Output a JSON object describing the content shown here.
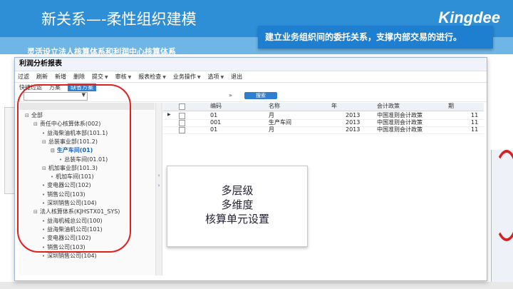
{
  "slide": {
    "title": "新关系—-柔性组织建模",
    "brand": "Kingdee",
    "subtitle": "灵活设立法人核算体系和利润中心核算体系",
    "callout": "建立业务组织间的委托关系，支撑内部交易的进行。"
  },
  "window": {
    "title": "利润分析报表",
    "toolbar": [
      "过滤",
      "刷新",
      "新增",
      "删除",
      "提交",
      "审核",
      "报表检查",
      "业务操作",
      "选项",
      "退出"
    ],
    "tabs": [
      "快捷过滤",
      "方案",
      "缺省方案"
    ],
    "search_label": "搜索",
    "collapse_icon": "double-chevron-down-icon"
  },
  "tree": [
    {
      "label": "全部",
      "level": 0,
      "toggle": "⊟"
    },
    {
      "label": "责任中心核算体系(002)",
      "level": 1,
      "toggle": "⊟"
    },
    {
      "label": "益海柴油机本部(101.1)",
      "level": 2,
      "toggle": "•"
    },
    {
      "label": "总装事业部(101.2)",
      "level": 2,
      "toggle": "⊟"
    },
    {
      "label": "生产车间(01)",
      "level": 3,
      "toggle": "⊟",
      "selected": true
    },
    {
      "label": "总装车间(01.01)",
      "level": 4,
      "toggle": "•"
    },
    {
      "label": "机加事业部(101.3)",
      "level": 2,
      "toggle": "⊟"
    },
    {
      "label": "机加车间(101)",
      "level": 3,
      "toggle": "•"
    },
    {
      "label": "变电器公司(102)",
      "level": 2,
      "toggle": "•"
    },
    {
      "label": "销售公司(103)",
      "level": 2,
      "toggle": "•"
    },
    {
      "label": "深圳销售公司(104)",
      "level": 2,
      "toggle": "•"
    },
    {
      "label": "法人核算体系(KJHSTX01_SYS)",
      "level": 1,
      "toggle": "⊟"
    },
    {
      "label": "益海机械总公司(100)",
      "level": 2,
      "toggle": "•"
    },
    {
      "label": "益海柴油机公司(101)",
      "level": 2,
      "toggle": "•"
    },
    {
      "label": "变电器公司(102)",
      "level": 2,
      "toggle": "•"
    },
    {
      "label": "销售公司(103)",
      "level": 2,
      "toggle": "•"
    },
    {
      "label": "深圳销售公司(104)",
      "level": 2,
      "toggle": "•"
    }
  ],
  "grid": {
    "headers": [
      "编码",
      "名称",
      "年",
      "会计政策",
      "期"
    ],
    "rows": [
      [
        "01",
        "月",
        "2013",
        "中国准则会计政策",
        "11"
      ],
      [
        "001",
        "生产车间",
        "2013",
        "中国准则会计政策",
        "11"
      ],
      [
        "01",
        "月",
        "2013",
        "中国准则会计政策",
        "11"
      ]
    ]
  },
  "textbox": [
    "多层级",
    "多维度",
    "核算单元设置"
  ],
  "colors": {
    "header": "#2e8fd6",
    "callout": "#1e7fd0",
    "highlight": "#e02020",
    "accent": "#2e7fd0"
  }
}
